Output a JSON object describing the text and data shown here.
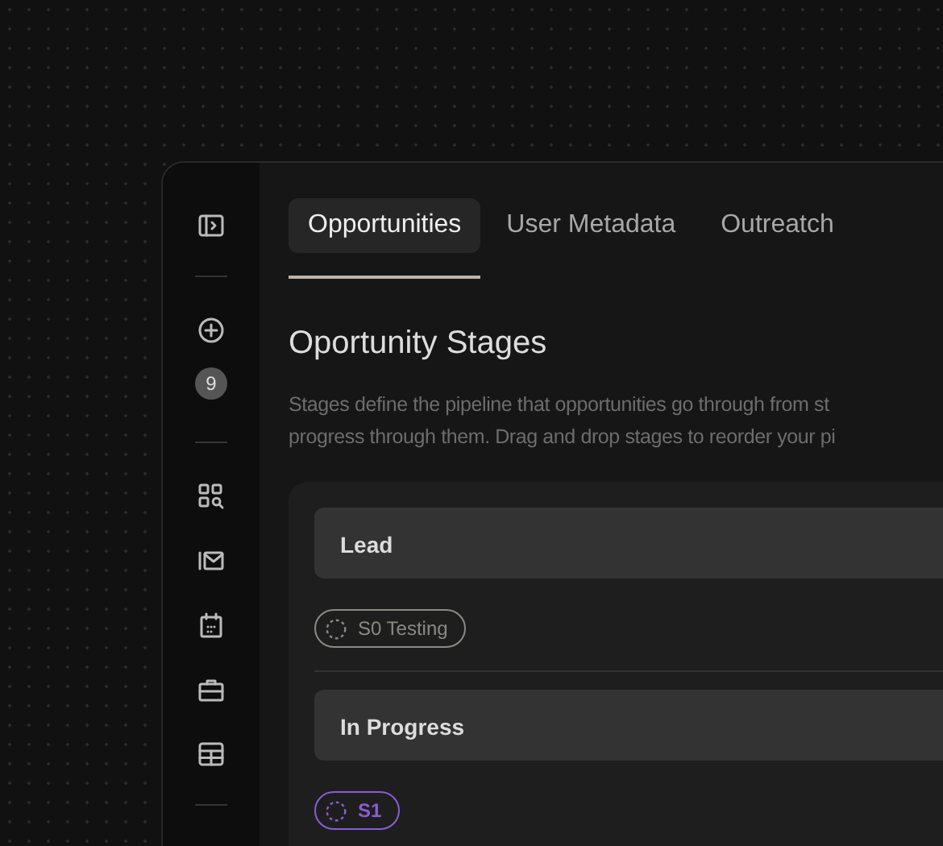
{
  "sidebar": {
    "badge": "9"
  },
  "tabs": [
    {
      "label": "Opportunities",
      "selected": true
    },
    {
      "label": "User Metadata",
      "selected": false
    },
    {
      "label": "Outreatch",
      "selected": false
    }
  ],
  "heading": "Oportunity Stages",
  "description": [
    "Stages define the pipeline that opportunities go through from st",
    "progress through them. Drag and drop stages to reorder your pi"
  ],
  "stages": [
    {
      "name": "Lead",
      "tag": {
        "label": "S0 Testing",
        "color": "#8a8a85"
      }
    },
    {
      "name": "In Progress",
      "tag": {
        "label": "S1",
        "color": "#8b5cd6"
      }
    }
  ]
}
